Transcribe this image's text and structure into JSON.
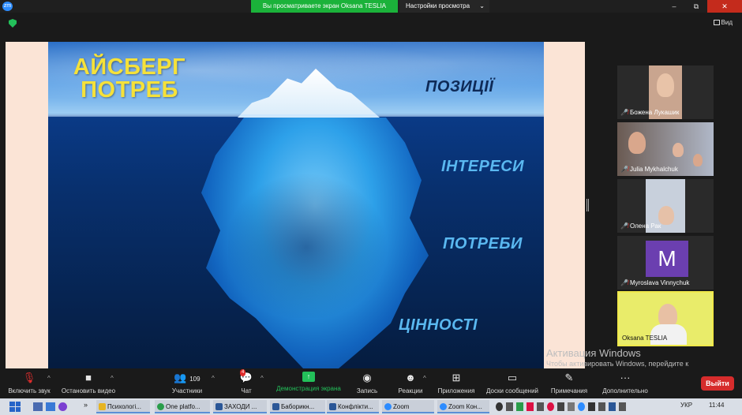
{
  "app": {
    "logo": "zm",
    "share_banner": "Вы просматриваете экран Oksana TESLIA",
    "view_settings": "Настройки просмотра",
    "view_label": "Вид"
  },
  "window_controls": {
    "minimize": "–",
    "maximize": "⧉",
    "close": "✕"
  },
  "slide": {
    "title": "АЙСБЕРГ ПОТРЕБ",
    "labels": [
      "ПОЗИЦІЇ",
      "ІНТЕРЕСИ",
      "ПОТРЕБИ",
      "ЦІННОСТІ"
    ]
  },
  "participants": [
    {
      "name": "Божена Лукашик",
      "muted": true
    },
    {
      "name": "Julia Mykhalchuk",
      "muted": true
    },
    {
      "name": "Олена Рак",
      "muted": true
    },
    {
      "name": "Myroslava Vinnychuk",
      "muted": true,
      "avatar_letter": "M"
    },
    {
      "name": "Oksana TESLIA",
      "muted": false,
      "active_speaker": true
    }
  ],
  "windows_activation": {
    "title": "Активация Windows",
    "body": "Чтобы активировать Windows, перейдите к параметрам компьютера."
  },
  "toolbar": {
    "mute": "Включить звук",
    "video": "Остановить видео",
    "participants": "Участники",
    "participants_count": "109",
    "chat": "Чат",
    "chat_badge": "4",
    "share": "Демонстрация экрана",
    "record": "Запись",
    "reactions": "Реакции",
    "apps": "Приложения",
    "whiteboards": "Доски сообщений",
    "notes": "Примечания",
    "more": "Дополнительно",
    "leave": "Выйти"
  },
  "taskbar": {
    "items": [
      "Психологі...",
      "One platfo...",
      "ЗАХОДИ ...",
      "Баборикн...",
      "Конфлікти...",
      "Zoom",
      "Zoom Кон..."
    ],
    "language": "УКР",
    "time": "11:44"
  },
  "colors": {
    "accent_green": "#23c05a",
    "leave_red": "#d62c2c",
    "slide_title": "#f5e13a",
    "active_speaker_border": "#f0e94a"
  }
}
